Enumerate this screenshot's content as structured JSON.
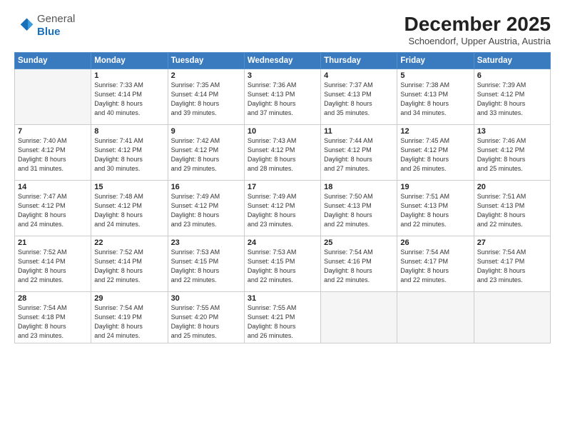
{
  "logo": {
    "general": "General",
    "blue": "Blue"
  },
  "title": "December 2025",
  "subtitle": "Schoendorf, Upper Austria, Austria",
  "days_header": [
    "Sunday",
    "Monday",
    "Tuesday",
    "Wednesday",
    "Thursday",
    "Friday",
    "Saturday"
  ],
  "weeks": [
    [
      {
        "day": "",
        "info": ""
      },
      {
        "day": "1",
        "info": "Sunrise: 7:33 AM\nSunset: 4:14 PM\nDaylight: 8 hours\nand 40 minutes."
      },
      {
        "day": "2",
        "info": "Sunrise: 7:35 AM\nSunset: 4:14 PM\nDaylight: 8 hours\nand 39 minutes."
      },
      {
        "day": "3",
        "info": "Sunrise: 7:36 AM\nSunset: 4:13 PM\nDaylight: 8 hours\nand 37 minutes."
      },
      {
        "day": "4",
        "info": "Sunrise: 7:37 AM\nSunset: 4:13 PM\nDaylight: 8 hours\nand 35 minutes."
      },
      {
        "day": "5",
        "info": "Sunrise: 7:38 AM\nSunset: 4:13 PM\nDaylight: 8 hours\nand 34 minutes."
      },
      {
        "day": "6",
        "info": "Sunrise: 7:39 AM\nSunset: 4:12 PM\nDaylight: 8 hours\nand 33 minutes."
      }
    ],
    [
      {
        "day": "7",
        "info": "Sunrise: 7:40 AM\nSunset: 4:12 PM\nDaylight: 8 hours\nand 31 minutes."
      },
      {
        "day": "8",
        "info": "Sunrise: 7:41 AM\nSunset: 4:12 PM\nDaylight: 8 hours\nand 30 minutes."
      },
      {
        "day": "9",
        "info": "Sunrise: 7:42 AM\nSunset: 4:12 PM\nDaylight: 8 hours\nand 29 minutes."
      },
      {
        "day": "10",
        "info": "Sunrise: 7:43 AM\nSunset: 4:12 PM\nDaylight: 8 hours\nand 28 minutes."
      },
      {
        "day": "11",
        "info": "Sunrise: 7:44 AM\nSunset: 4:12 PM\nDaylight: 8 hours\nand 27 minutes."
      },
      {
        "day": "12",
        "info": "Sunrise: 7:45 AM\nSunset: 4:12 PM\nDaylight: 8 hours\nand 26 minutes."
      },
      {
        "day": "13",
        "info": "Sunrise: 7:46 AM\nSunset: 4:12 PM\nDaylight: 8 hours\nand 25 minutes."
      }
    ],
    [
      {
        "day": "14",
        "info": "Sunrise: 7:47 AM\nSunset: 4:12 PM\nDaylight: 8 hours\nand 24 minutes."
      },
      {
        "day": "15",
        "info": "Sunrise: 7:48 AM\nSunset: 4:12 PM\nDaylight: 8 hours\nand 24 minutes."
      },
      {
        "day": "16",
        "info": "Sunrise: 7:49 AM\nSunset: 4:12 PM\nDaylight: 8 hours\nand 23 minutes."
      },
      {
        "day": "17",
        "info": "Sunrise: 7:49 AM\nSunset: 4:12 PM\nDaylight: 8 hours\nand 23 minutes."
      },
      {
        "day": "18",
        "info": "Sunrise: 7:50 AM\nSunset: 4:13 PM\nDaylight: 8 hours\nand 22 minutes."
      },
      {
        "day": "19",
        "info": "Sunrise: 7:51 AM\nSunset: 4:13 PM\nDaylight: 8 hours\nand 22 minutes."
      },
      {
        "day": "20",
        "info": "Sunrise: 7:51 AM\nSunset: 4:13 PM\nDaylight: 8 hours\nand 22 minutes."
      }
    ],
    [
      {
        "day": "21",
        "info": "Sunrise: 7:52 AM\nSunset: 4:14 PM\nDaylight: 8 hours\nand 22 minutes."
      },
      {
        "day": "22",
        "info": "Sunrise: 7:52 AM\nSunset: 4:14 PM\nDaylight: 8 hours\nand 22 minutes."
      },
      {
        "day": "23",
        "info": "Sunrise: 7:53 AM\nSunset: 4:15 PM\nDaylight: 8 hours\nand 22 minutes."
      },
      {
        "day": "24",
        "info": "Sunrise: 7:53 AM\nSunset: 4:15 PM\nDaylight: 8 hours\nand 22 minutes."
      },
      {
        "day": "25",
        "info": "Sunrise: 7:54 AM\nSunset: 4:16 PM\nDaylight: 8 hours\nand 22 minutes."
      },
      {
        "day": "26",
        "info": "Sunrise: 7:54 AM\nSunset: 4:17 PM\nDaylight: 8 hours\nand 22 minutes."
      },
      {
        "day": "27",
        "info": "Sunrise: 7:54 AM\nSunset: 4:17 PM\nDaylight: 8 hours\nand 23 minutes."
      }
    ],
    [
      {
        "day": "28",
        "info": "Sunrise: 7:54 AM\nSunset: 4:18 PM\nDaylight: 8 hours\nand 23 minutes."
      },
      {
        "day": "29",
        "info": "Sunrise: 7:54 AM\nSunset: 4:19 PM\nDaylight: 8 hours\nand 24 minutes."
      },
      {
        "day": "30",
        "info": "Sunrise: 7:55 AM\nSunset: 4:20 PM\nDaylight: 8 hours\nand 25 minutes."
      },
      {
        "day": "31",
        "info": "Sunrise: 7:55 AM\nSunset: 4:21 PM\nDaylight: 8 hours\nand 26 minutes."
      },
      {
        "day": "",
        "info": ""
      },
      {
        "day": "",
        "info": ""
      },
      {
        "day": "",
        "info": ""
      }
    ]
  ]
}
